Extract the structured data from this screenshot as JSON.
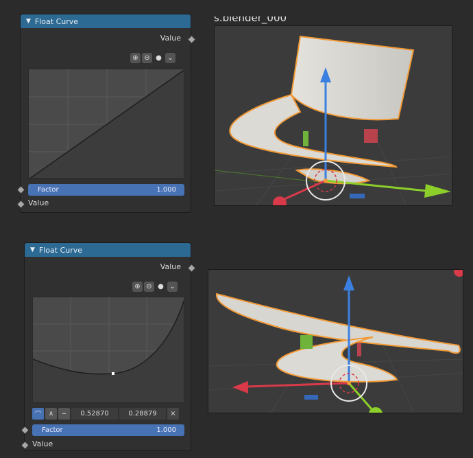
{
  "top_node": {
    "title": "Float Curve",
    "output_label": "Value",
    "factor_label": "Factor",
    "factor_value": "1.000",
    "input_label": "Value",
    "tools": [
      "zoom-in-icon",
      "zoom-out-icon",
      "dot-icon",
      "chevron-down-icon"
    ],
    "curve_points": [
      [
        0,
        0
      ],
      [
        1,
        1
      ]
    ]
  },
  "bottom_node": {
    "title": "Float Curve",
    "output_label": "Value",
    "factor_label": "Factor",
    "factor_value": "1.000",
    "input_label": "Value",
    "point_x": "0.52870",
    "point_y": "0.28879",
    "close_glyph": "×",
    "tools": [
      "zoom-in-icon",
      "zoom-out-icon",
      "dot-icon",
      "chevron-down-icon"
    ],
    "handle_types": [
      "auto-clamped-handle-icon",
      "vector-handle-icon",
      "auto-handle-icon"
    ],
    "selected_point": [
      0.5287,
      0.28879
    ]
  },
  "top_viewport": {
    "cut_title": "s.blender_000"
  },
  "colors": {
    "node_header": "#2d6a93",
    "factor_bar": "#4772b3",
    "selection_outline": "#f29a36",
    "axis_x": "#d83a4a",
    "axis_y": "#8ccf2a",
    "axis_z": "#3a80e0"
  }
}
